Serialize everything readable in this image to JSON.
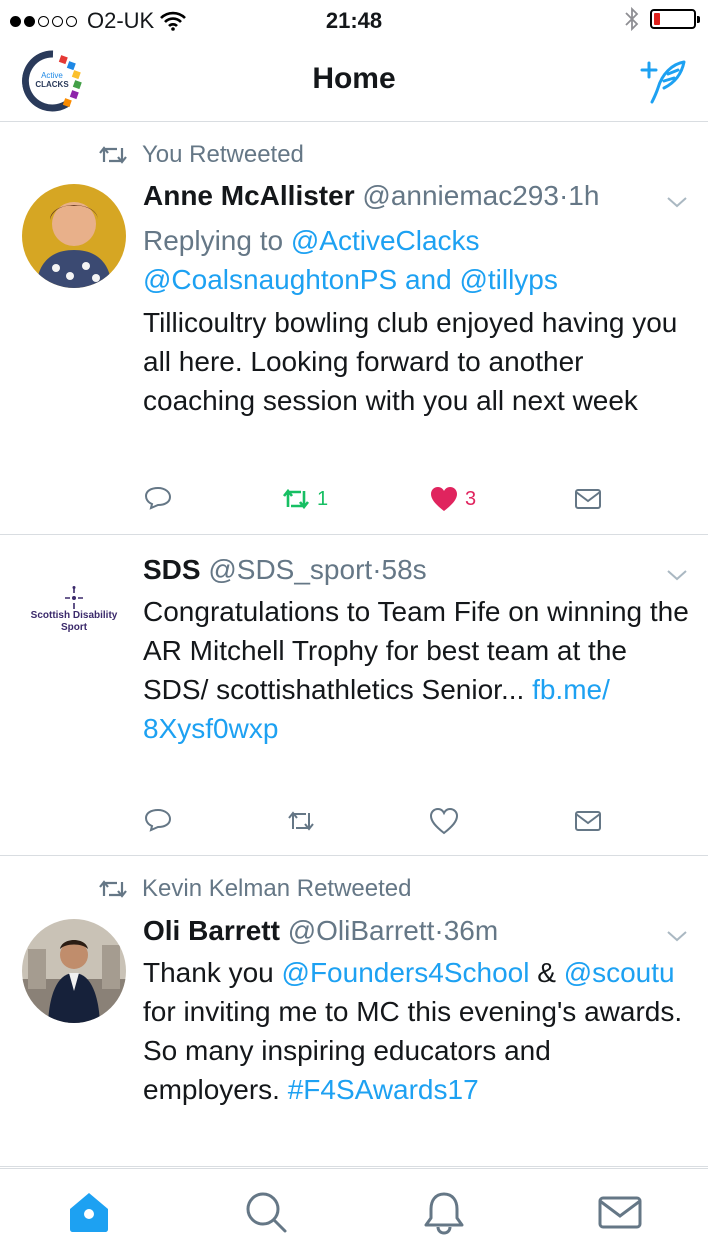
{
  "status_bar": {
    "carrier": "O2-UK",
    "time": "21:48",
    "battery_level": 0.15
  },
  "nav": {
    "title": "Home",
    "logo_text_top": "Active",
    "logo_text_bottom": "CLACKS"
  },
  "tweets": [
    {
      "retweeted_by": "You Retweeted",
      "name": "Anne McAllister",
      "handle": "@anniemac293",
      "sep": "·",
      "time": "1h",
      "replying_prefix": "Replying to",
      "replying_1": "@ActiveClacks",
      "replying_2": "@CoalsnaughtonPS",
      "replying_and": "and",
      "replying_3": "@tillyps",
      "text": "Tillicoultry bowling club enjoyed having you all here. Looking forward to another coaching session with you all next week",
      "retweet_count": "1",
      "like_count": "3"
    },
    {
      "name": "SDS",
      "handle": "@SDS_sport",
      "sep": "·",
      "time": "58s",
      "text": "Congratulations to Team Fife on winning the AR Mitchell Trophy for best team at the SDS/ scottishathletics Senior...",
      "link_1": "fb.me/",
      "link_2": "8Xysf0wxp",
      "logo_line_1": "Scottish Disability",
      "logo_line_2": "Sport"
    },
    {
      "retweeted_by": "Kevin Kelman Retweeted",
      "name": "Oli Barrett",
      "handle": "@OliBarrett",
      "sep": "·",
      "time": "36m",
      "text_1": "Thank you",
      "mention_1": "@Founders4School",
      "text_amp": "&",
      "mention_2": "@scoutu",
      "text_2": "for inviting me to MC this evening's awards. So many inspiring educators and employers.",
      "hashtag": "#F4SAwards17"
    }
  ],
  "colors": {
    "accent": "#1da1f2",
    "retweet_green": "#17bf63",
    "like_pink": "#e0245e",
    "muted": "#657786"
  },
  "icons": [
    "wifi-icon",
    "bluetooth-icon",
    "battery-icon",
    "compose-icon",
    "retweet-icon",
    "chevron-down-icon",
    "reply-icon",
    "like-icon",
    "dm-icon",
    "home-icon",
    "search-icon",
    "notifications-icon",
    "messages-icon"
  ]
}
